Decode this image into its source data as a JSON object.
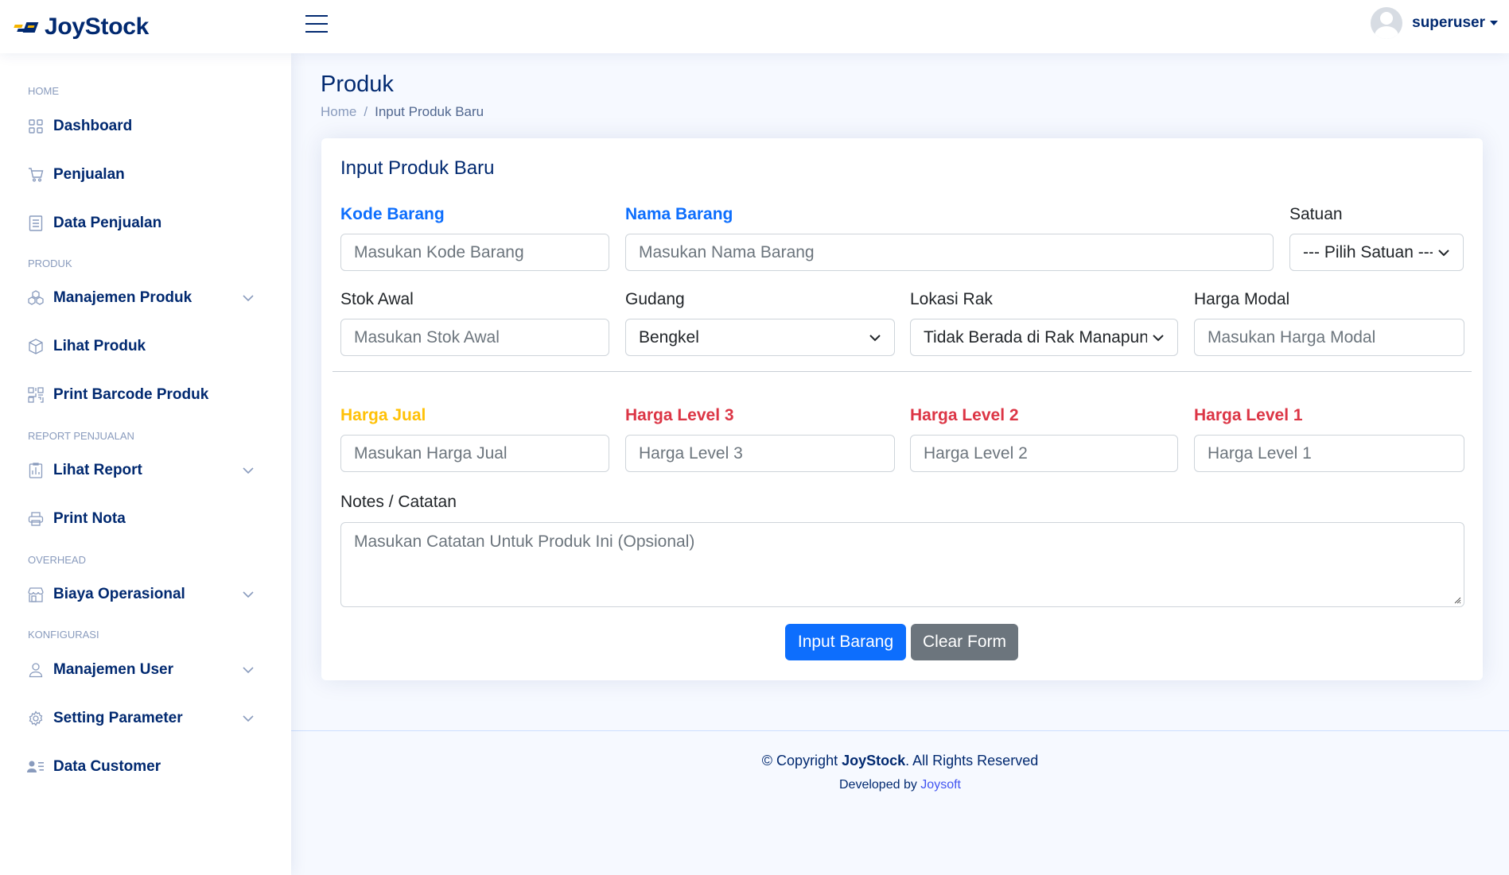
{
  "header": {
    "logo_text": "JoyStock",
    "username": "superuser"
  },
  "sidebar": {
    "sections": [
      {
        "heading": "HOME",
        "items": [
          {
            "label": "Dashboard",
            "icon": "grid-icon",
            "has_chevron": false
          },
          {
            "label": "Penjualan",
            "icon": "cart-icon",
            "has_chevron": false
          },
          {
            "label": "Data Penjualan",
            "icon": "receipt-icon",
            "has_chevron": false
          }
        ]
      },
      {
        "heading": "PRODUK",
        "items": [
          {
            "label": "Manajemen Produk",
            "icon": "boxes-icon",
            "has_chevron": true
          },
          {
            "label": "Lihat Produk",
            "icon": "box-icon",
            "has_chevron": false
          },
          {
            "label": "Print Barcode Produk",
            "icon": "qr-code-icon",
            "has_chevron": false
          }
        ]
      },
      {
        "heading": "REPORT PENJUALAN",
        "items": [
          {
            "label": "Lihat Report",
            "icon": "report-icon",
            "has_chevron": true
          },
          {
            "label": "Print Nota",
            "icon": "printer-icon",
            "has_chevron": false
          }
        ]
      },
      {
        "heading": "OVERHEAD",
        "items": [
          {
            "label": "Biaya Operasional",
            "icon": "shop-icon",
            "has_chevron": true
          }
        ]
      },
      {
        "heading": "KONFIGURASI",
        "items": [
          {
            "label": "Manajemen User",
            "icon": "person-icon",
            "has_chevron": true
          },
          {
            "label": "Setting Parameter",
            "icon": "gear-icon",
            "has_chevron": true
          },
          {
            "label": "Data Customer",
            "icon": "person-lines-icon",
            "has_chevron": false
          }
        ]
      }
    ]
  },
  "page": {
    "title": "Produk",
    "breadcrumb": {
      "home": "Home",
      "separator": "/",
      "current": "Input Produk Baru"
    }
  },
  "form": {
    "title": "Input Produk Baru",
    "kode_barang": {
      "label": "Kode Barang",
      "placeholder": "Masukan Kode Barang"
    },
    "nama_barang": {
      "label": "Nama Barang",
      "placeholder": "Masukan Nama Barang"
    },
    "satuan": {
      "label": "Satuan",
      "value": "--- Pilih Satuan ---"
    },
    "stok_awal": {
      "label": "Stok Awal",
      "placeholder": "Masukan Stok Awal"
    },
    "gudang": {
      "label": "Gudang",
      "value": "Bengkel"
    },
    "lokasi_rak": {
      "label": "Lokasi Rak",
      "value": "Tidak Berada di Rak Manapun"
    },
    "harga_modal": {
      "label": "Harga Modal",
      "placeholder": "Masukan Harga Modal"
    },
    "harga_jual": {
      "label": "Harga Jual",
      "placeholder": "Masukan Harga Jual"
    },
    "harga_level_3": {
      "label": "Harga Level 3",
      "placeholder": "Harga Level 3"
    },
    "harga_level_2": {
      "label": "Harga Level 2",
      "placeholder": "Harga Level 2"
    },
    "harga_level_1": {
      "label": "Harga Level 1",
      "placeholder": "Harga Level 1"
    },
    "notes": {
      "label": "Notes / Catatan",
      "placeholder": "Masukan Catatan Untuk Produk Ini (Opsional)"
    },
    "submit_label": "Input Barang",
    "clear_label": "Clear Form"
  },
  "footer": {
    "copyright_prefix": "© Copyright ",
    "brand": "JoyStock",
    "copyright_suffix": ". All Rights Reserved",
    "developed_prefix": "Developed by ",
    "developer": "Joysoft"
  },
  "colors": {
    "brand": "#012970",
    "accent_blue": "#0d6efd",
    "gold": "#ffc107",
    "red": "#dc3545",
    "secondary": "#6c757d"
  }
}
